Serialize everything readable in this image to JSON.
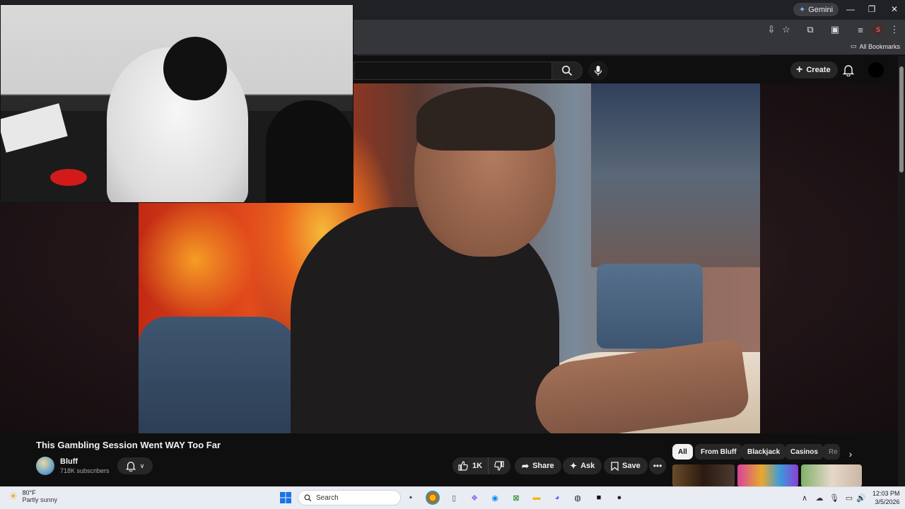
{
  "browser": {
    "gemini_label": "Gemini",
    "profile_initial": "S",
    "bookmarks_label": "All Bookmarks"
  },
  "youtube": {
    "create_label": "Create",
    "video": {
      "title": "This Gambling Session Went WAY Too Far",
      "channel_name": "Bluff",
      "subscribers": "718K subscribers",
      "likes": "1K",
      "share_label": "Share",
      "ask_label": "Ask",
      "save_label": "Save"
    },
    "chips": [
      "All",
      "From Bluff",
      "Blackjack",
      "Casinos",
      "Re"
    ]
  },
  "taskbar": {
    "weather_temp": "80°F",
    "weather_desc": "Partly sunny",
    "search_placeholder": "Search",
    "time": "12:03 PM",
    "date": "3/5/2026"
  },
  "colors": {
    "accent_like_bg": "#272727",
    "youtube_bg": "#0f0f0f",
    "taskbar_bg": "#e9edf3"
  }
}
